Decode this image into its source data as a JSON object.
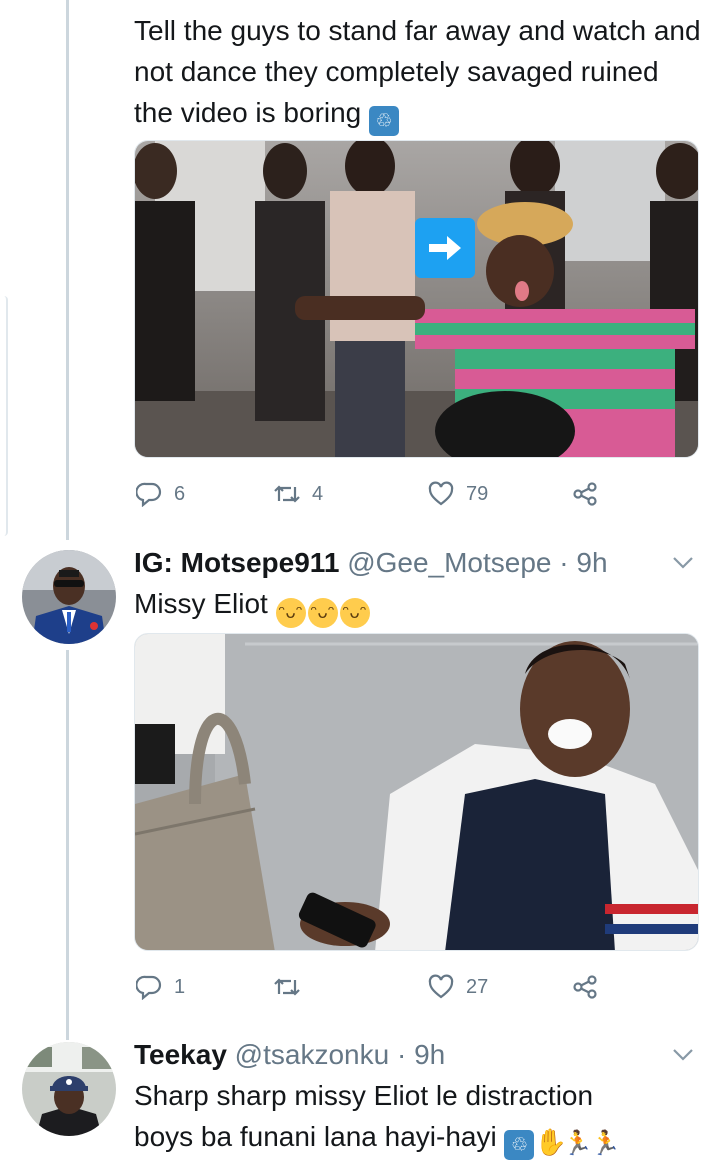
{
  "tweet1": {
    "text": "Tell the guys to stand far away and watch and not dance they completely savaged ruined the video is boring",
    "emoji": "🚮",
    "media_arrow_icon": "arrow-right-icon",
    "replies": "6",
    "retweets": "4",
    "likes": "79"
  },
  "tweet2": {
    "name": "IG: Motsepe911",
    "handle": "@Gee_Motsepe",
    "sep": " · ",
    "time": "9h",
    "text": "Missy Eliot",
    "emojis": [
      "😂",
      "😂",
      "😂"
    ],
    "replies": "1",
    "retweets": "",
    "likes": "27"
  },
  "tweet3": {
    "name": "Teekay",
    "handle": "@tsakzonku",
    "sep": " · ",
    "time": "9h",
    "text_line1": "Sharp sharp missy Eliot le distraction",
    "text_line2": "boys ba funani lana hayi-hayi",
    "emojis": [
      "🚮",
      "🖐",
      "🏃",
      "🏃"
    ]
  },
  "colors": {
    "text": "#14171a",
    "secondary": "#657786",
    "thread": "#ccd6dd",
    "media_arrow": "#1da1f2"
  }
}
